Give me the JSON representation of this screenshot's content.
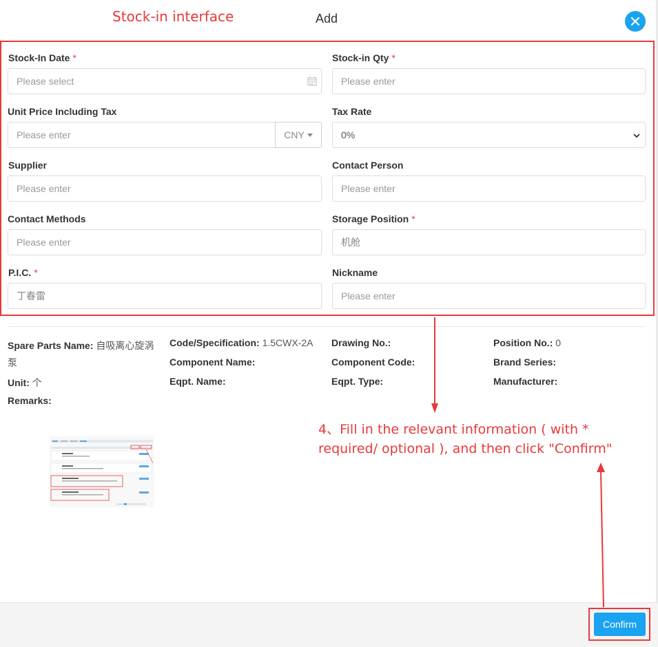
{
  "annotation": {
    "title": "Stock-in interface",
    "note": "4、Fill in the relevant information ( with * required/ optional ), and then click \"Confirm\""
  },
  "modal": {
    "title": "Add"
  },
  "form": {
    "stock_in_date": {
      "label": "Stock-In Date",
      "placeholder": "Please select",
      "required": "*"
    },
    "stock_in_qty": {
      "label": "Stock-in Qty",
      "placeholder": "Please enter",
      "required": "*"
    },
    "unit_price": {
      "label": "Unit Price Including Tax",
      "placeholder": "Please enter",
      "currency": "CNY"
    },
    "tax_rate": {
      "label": "Tax Rate",
      "value": "0%"
    },
    "supplier": {
      "label": "Supplier",
      "placeholder": "Please enter"
    },
    "contact_person": {
      "label": "Contact Person",
      "placeholder": "Please enter"
    },
    "contact_methods": {
      "label": "Contact Methods",
      "placeholder": "Please enter"
    },
    "storage_position": {
      "label": "Storage Position",
      "value": "机舱",
      "required": "*"
    },
    "pic": {
      "label": "P.I.C.",
      "value": "丁春雷",
      "required": "*"
    },
    "nickname": {
      "label": "Nickname",
      "placeholder": "Please enter"
    }
  },
  "details": {
    "spare_parts_name": {
      "label": "Spare Parts Name:",
      "value": "自吸离心旋涡",
      "value_cont": "泵"
    },
    "code_spec": {
      "label": "Code/Specification:",
      "value": "1.5CWX-2A"
    },
    "drawing_no": {
      "label": "Drawing No.:",
      "value": ""
    },
    "position_no": {
      "label": "Position No.:",
      "value": "0"
    },
    "component_name": {
      "label": "Component Name:",
      "value": ""
    },
    "component_code": {
      "label": "Component Code:",
      "value": ""
    },
    "brand_series": {
      "label": "Brand Series:",
      "value": ""
    },
    "unit": {
      "label": "Unit:",
      "value": "个"
    },
    "eqpt_name": {
      "label": "Eqpt. Name:",
      "value": ""
    },
    "eqpt_type": {
      "label": "Eqpt. Type:",
      "value": ""
    },
    "manufacturer": {
      "label": "Manufacturer:",
      "value": ""
    },
    "remarks": {
      "label": "Remarks:",
      "value": ""
    }
  },
  "footer": {
    "confirm_label": "Confirm"
  },
  "colors": {
    "accent": "#1aa3f0",
    "annotation": "#e8393a"
  }
}
